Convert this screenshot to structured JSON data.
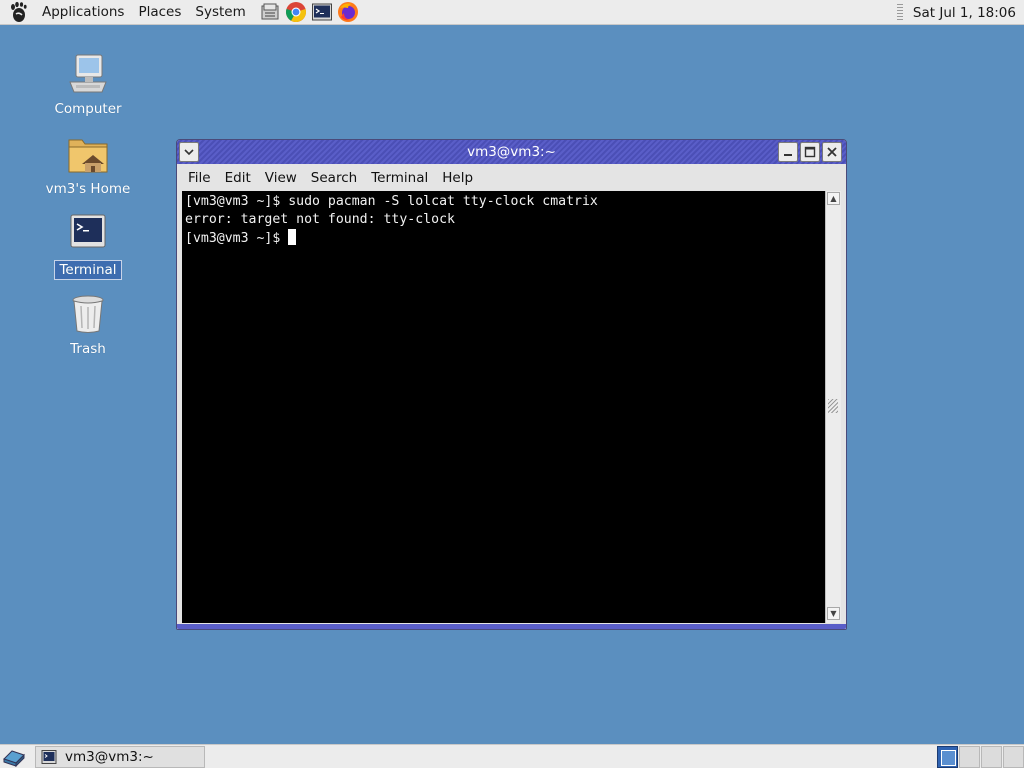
{
  "top_panel": {
    "menus": [
      "Applications",
      "Places",
      "System"
    ],
    "clock": "Sat Jul 1, 18:06"
  },
  "desktop": {
    "icons": [
      {
        "label": "Computer"
      },
      {
        "label": "vm3's Home"
      },
      {
        "label": "Terminal"
      },
      {
        "label": "Trash"
      }
    ]
  },
  "window": {
    "title": "vm3@vm3:~",
    "menu": [
      "File",
      "Edit",
      "View",
      "Search",
      "Terminal",
      "Help"
    ],
    "lines": [
      "[vm3@vm3 ~]$ sudo pacman -S lolcat tty-clock cmatrix",
      "error: target not found: tty-clock",
      "[vm3@vm3 ~]$ "
    ]
  },
  "taskbar": {
    "task_label": "vm3@vm3:~"
  },
  "colors": {
    "desktop_bg": "#5b8fbf",
    "titlebar": "#5a5ec8",
    "terminal_bg": "#000000",
    "terminal_fg": "#f2f2f2"
  }
}
